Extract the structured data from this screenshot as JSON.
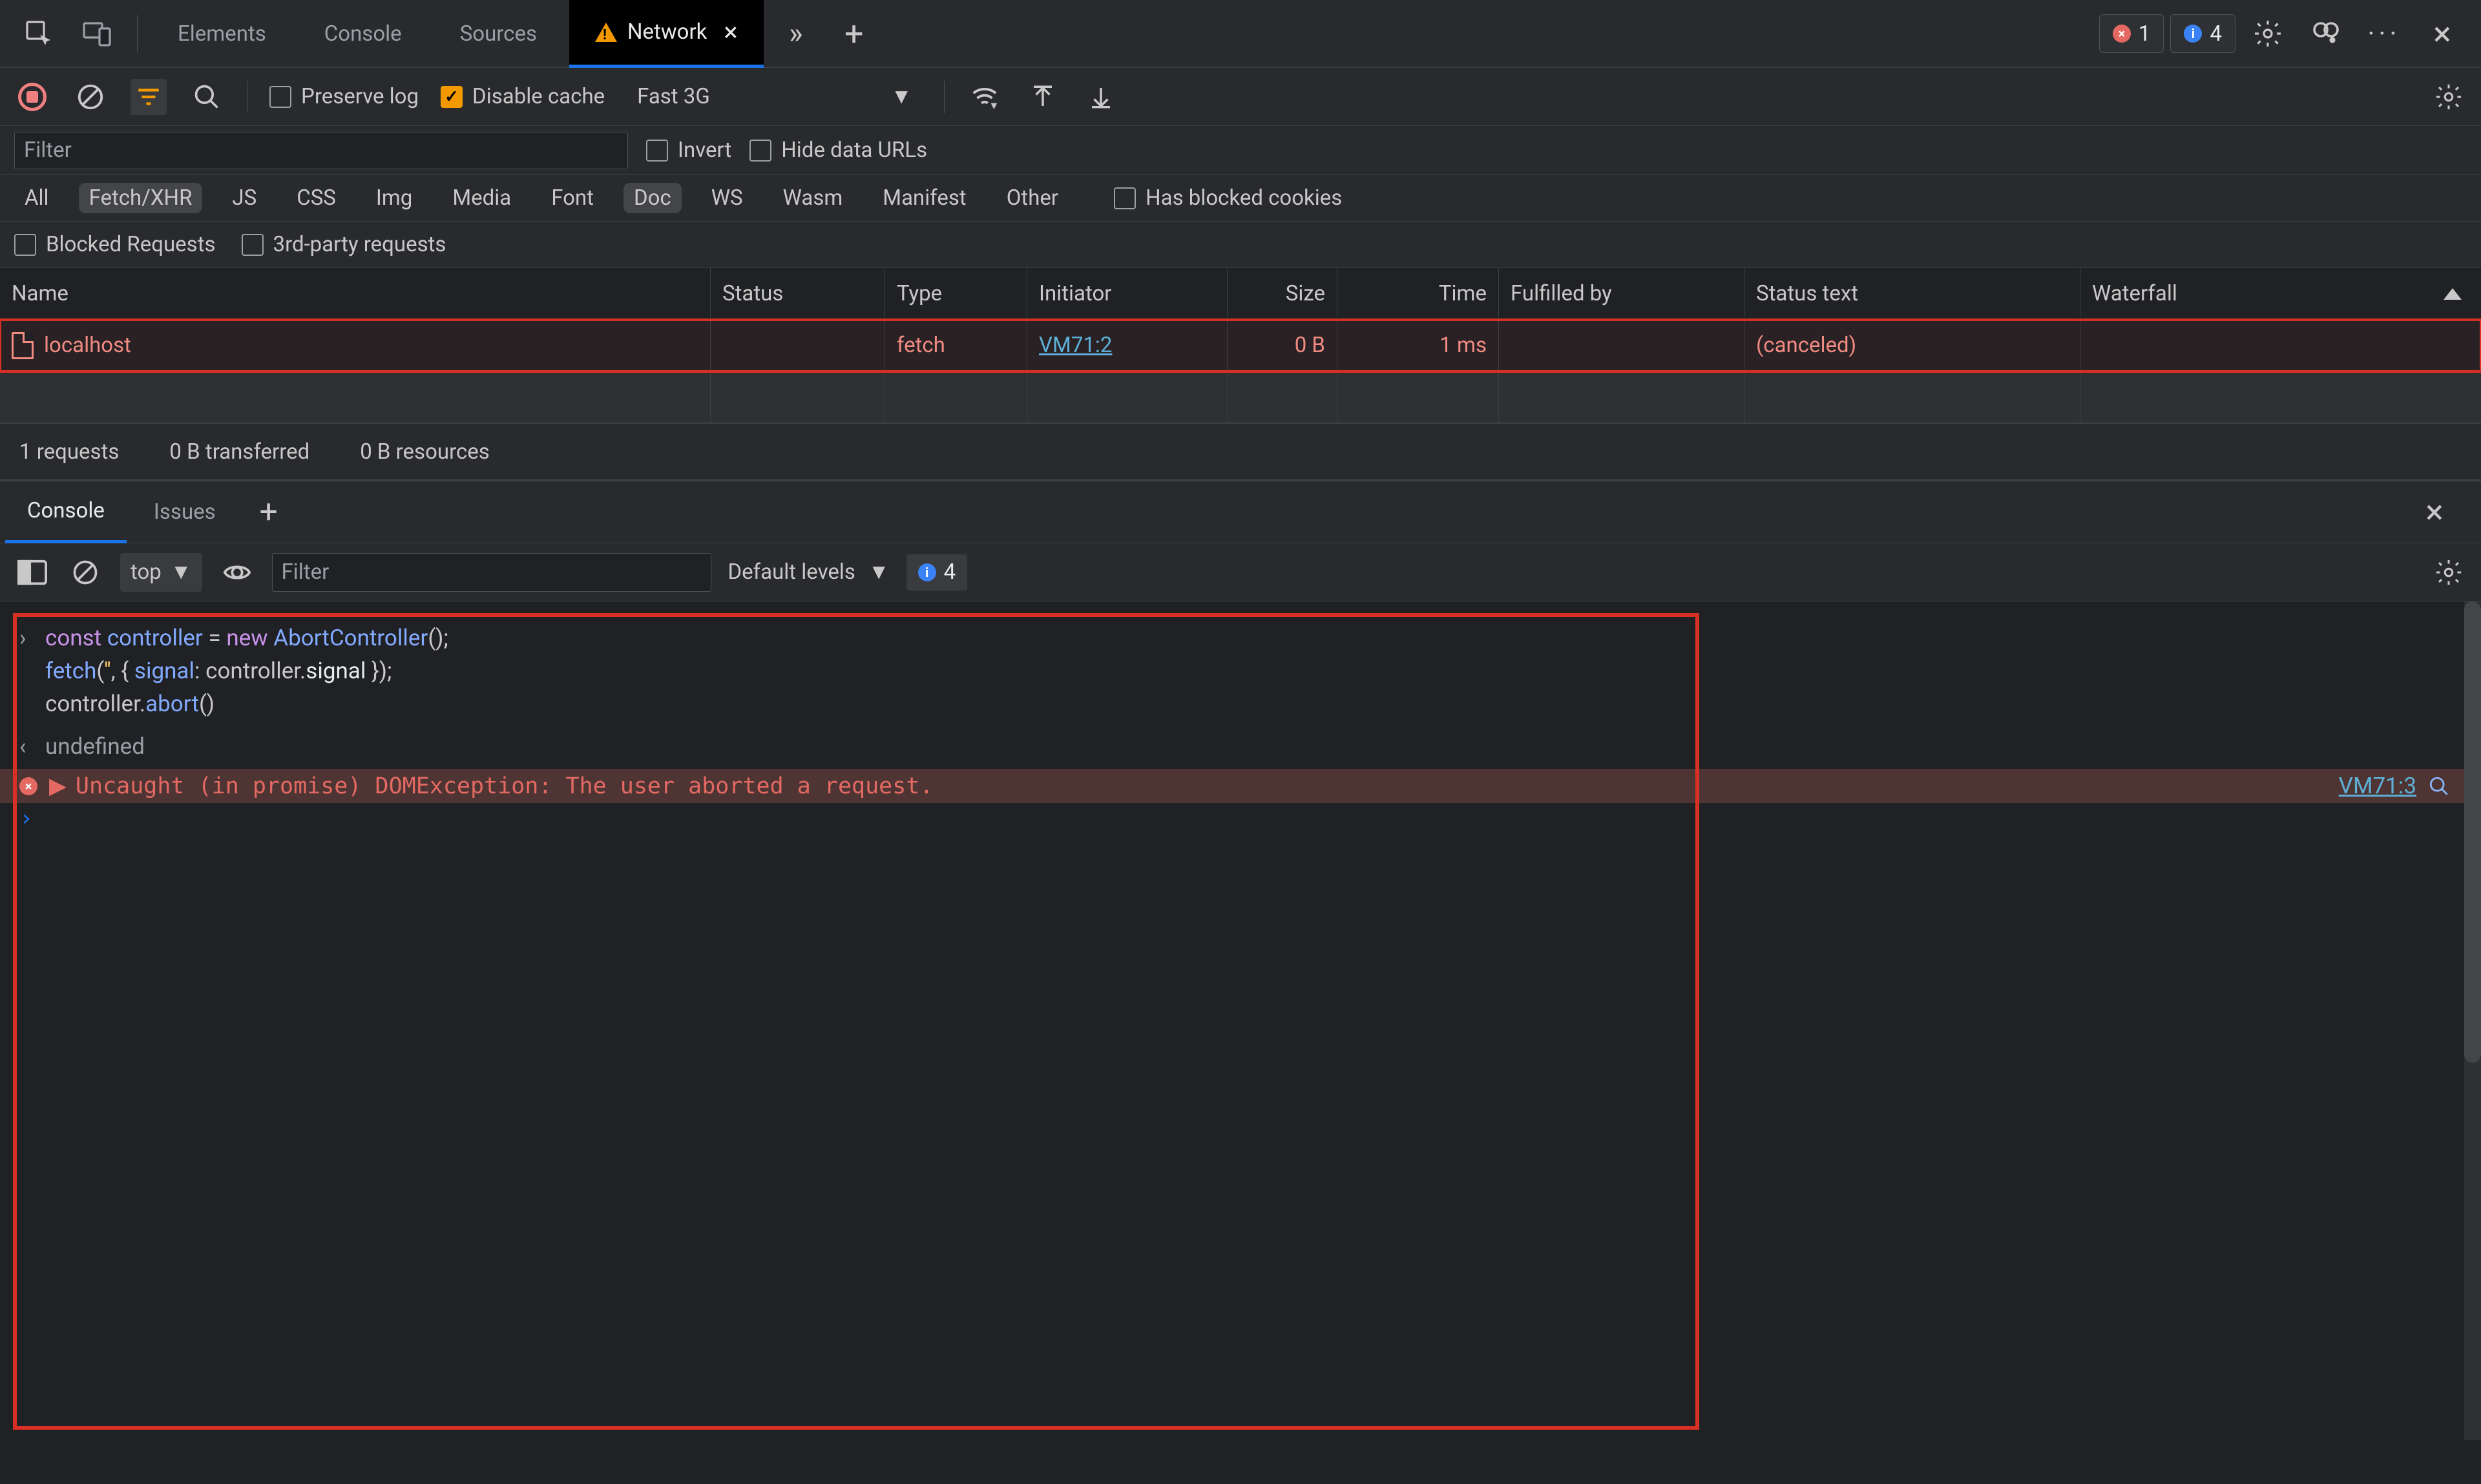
{
  "topbar": {
    "tabs": [
      "Elements",
      "Console",
      "Sources",
      "Network"
    ],
    "active_tab": "Network",
    "error_count": "1",
    "issue_count": "4"
  },
  "network_toolbar": {
    "preserve_log_label": "Preserve log",
    "preserve_log_checked": false,
    "disable_cache_label": "Disable cache",
    "disable_cache_checked": true,
    "throttle": "Fast 3G"
  },
  "filter": {
    "filter_placeholder": "Filter",
    "invert_label": "Invert",
    "hide_urls_label": "Hide data URLs",
    "types": [
      "All",
      "Fetch/XHR",
      "JS",
      "CSS",
      "Img",
      "Media",
      "Font",
      "Doc",
      "WS",
      "Wasm",
      "Manifest",
      "Other"
    ],
    "types_selected": [
      "Fetch/XHR",
      "Doc"
    ],
    "has_blocked_cookies_label": "Has blocked cookies",
    "blocked_requests_label": "Blocked Requests",
    "third_party_label": "3rd-party requests"
  },
  "table": {
    "columns": [
      "Name",
      "Status",
      "Type",
      "Initiator",
      "Size",
      "Time",
      "Fulfilled by",
      "Status text",
      "Waterfall"
    ],
    "rows": [
      {
        "name": "localhost",
        "status": "",
        "type": "fetch",
        "initiator": "VM71:2",
        "size": "0 B",
        "time": "1 ms",
        "fulfilled_by": "",
        "status_text": "(canceled)"
      }
    ]
  },
  "summary": {
    "requests": "1 requests",
    "transferred": "0 B transferred",
    "resources": "0 B resources"
  },
  "drawer": {
    "tabs": [
      "Console",
      "Issues"
    ],
    "active": "Console"
  },
  "console_toolbar": {
    "context": "top",
    "filter_placeholder": "Filter",
    "levels_label": "Default levels",
    "issue_count": "4"
  },
  "console": {
    "code_line1": "const controller = new AbortController();",
    "code_line2": "fetch('', { signal: controller.signal });",
    "code_line3": "controller.abort()",
    "result": "undefined",
    "error": "Uncaught (in promise) DOMException: The user aborted a request.",
    "error_source": "VM71:3"
  }
}
